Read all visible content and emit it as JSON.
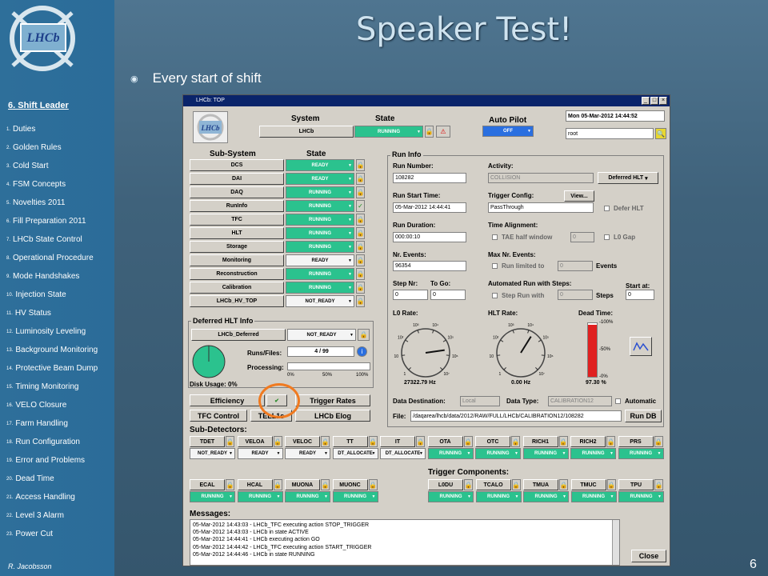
{
  "slide": {
    "title": "Speaker Test!",
    "bullet": "Every start of shift",
    "page_number": "6",
    "author": "R. Jacobsson",
    "logo_text": "LHCb"
  },
  "nav": {
    "heading": "6. Shift Leader",
    "items": [
      {
        "n": "1.",
        "label": "Duties"
      },
      {
        "n": "2.",
        "label": "Golden Rules"
      },
      {
        "n": "3.",
        "label": "Cold Start"
      },
      {
        "n": "4.",
        "label": "FSM Concepts"
      },
      {
        "n": "5.",
        "label": "Novelties 2011"
      },
      {
        "n": "6.",
        "label": "Fill Preparation 2011"
      },
      {
        "n": "7.",
        "label": "LHCb State Control"
      },
      {
        "n": "8.",
        "label": "Operational Procedure"
      },
      {
        "n": "9.",
        "label": "Mode Handshakes"
      },
      {
        "n": "10.",
        "label": "Injection State"
      },
      {
        "n": "11.",
        "label": "HV Status"
      },
      {
        "n": "12.",
        "label": "Luminosity Leveling"
      },
      {
        "n": "13.",
        "label": "Background Monitoring"
      },
      {
        "n": "14.",
        "label": "Protective Beam Dump"
      },
      {
        "n": "15.",
        "label": "Timing Monitoring"
      },
      {
        "n": "16.",
        "label": "VELO Closure"
      },
      {
        "n": "17.",
        "label": "Farm Handling"
      },
      {
        "n": "18.",
        "label": "Run Configuration"
      },
      {
        "n": "19.",
        "label": "Error and Problems"
      },
      {
        "n": "20.",
        "label": "Dead Time"
      },
      {
        "n": "21.",
        "label": "Access Handling"
      },
      {
        "n": "22.",
        "label": "Level 3 Alarm"
      },
      {
        "n": "23.",
        "label": "Power Cut"
      }
    ]
  },
  "window": {
    "title": "LHCb: TOP",
    "system_label": "System",
    "state_label": "State",
    "system_value": "LHCb",
    "system_state": "RUNNING",
    "autopilot_label": "Auto Pilot",
    "autopilot_state": "OFF",
    "datetime": "Mon 05-Mar-2012     14:44:52",
    "user": "root",
    "subsystem_label": "Sub-System",
    "subsystem_state_label": "State",
    "subsystems": [
      {
        "name": "DCS",
        "state": "READY",
        "color": "green"
      },
      {
        "name": "DAI",
        "state": "READY",
        "color": "green"
      },
      {
        "name": "DAQ",
        "state": "RUNNING",
        "color": "green"
      },
      {
        "name": "RunInfo",
        "state": "RUNNING",
        "color": "green"
      },
      {
        "name": "TFC",
        "state": "RUNNING",
        "color": "green"
      },
      {
        "name": "HLT",
        "state": "RUNNING",
        "color": "green"
      },
      {
        "name": "Storage",
        "state": "RUNNING",
        "color": "green"
      },
      {
        "name": "Monitoring",
        "state": "READY",
        "color": "white"
      },
      {
        "name": "Reconstruction",
        "state": "RUNNING",
        "color": "green"
      },
      {
        "name": "Calibration",
        "state": "RUNNING",
        "color": "green"
      },
      {
        "name": "LHCb_HV_TOP",
        "state": "NOT_READY",
        "color": "white"
      }
    ],
    "deferred": {
      "title": "Deferred HLT Info",
      "name": "LHCb_Deferred",
      "state": "NOT_READY",
      "runs_files_label": "Runs/Files:",
      "runs_files": "4 / 99",
      "processing_label": "Processing:",
      "scale": [
        "0%",
        "50%",
        "100%"
      ],
      "disk_usage": "Disk Usage: 0%",
      "disk_usage_fraction": 0.0
    },
    "run_info": {
      "title": "Run Info",
      "run_number_label": "Run Number:",
      "run_number": "108282",
      "activity_label": "Activity:",
      "activity": "COLLISION",
      "deferred_hlt_btn": "Deferred HLT",
      "run_start_label": "Run Start Time:",
      "run_start": "05-Mar-2012 14:44:41",
      "trigger_config_label": "Trigger Config:",
      "trigger_config": "PassThrough",
      "view_btn": "View...",
      "defer_hlt_label": "Defer HLT",
      "run_duration_label": "Run Duration:",
      "run_duration": "000:00:10",
      "time_alignment_label": "Time Alignment:",
      "tae_label": "TAE half window",
      "tae_value": "0",
      "l0gap_label": "L0 Gap",
      "nr_events_label": "Nr. Events:",
      "nr_events": "96354",
      "max_events_label": "Max Nr. Events:",
      "run_limited_label": "Run limited to",
      "run_limited_value": "0",
      "events_label": "Events",
      "step_nr_label": "Step Nr:",
      "step_nr": "0",
      "to_go_label": "To Go:",
      "to_go": "0",
      "automated_label": "Automated Run with Steps:",
      "step_run_label": "Step Run with",
      "step_run_value": "0",
      "steps_label": "Steps",
      "start_at_label": "Start at:",
      "start_at": "0"
    },
    "rates": {
      "l0_label": "L0 Rate:",
      "l0_value": "27322.79 Hz",
      "hlt_label": "HLT Rate:",
      "hlt_value": "0.00 Hz",
      "dead_label": "Dead Time:",
      "dead_value": "97.30 %",
      "dead_fraction": 0.973,
      "dead_scale": [
        "-100%",
        "-50%",
        "-0%"
      ],
      "gauge_ticks": [
        "1",
        "10",
        "10²",
        "10³",
        "10⁴",
        "10⁵",
        "10⁶",
        "10⁷"
      ]
    },
    "buttons": {
      "efficiency": "Efficiency",
      "trigger_rates": "Trigger Rates",
      "tfc_control": "TFC Control",
      "tell1": "TELL1s",
      "lhcb_elog": "LHCb Elog",
      "run_db": "Run DB",
      "close": "Close"
    },
    "data_destination_label": "Data Destination:",
    "data_destination": "Local",
    "data_type_label": "Data Type:",
    "data_type": "CALIBRATION12",
    "automatic_label": "Automatic",
    "file_label": "File:",
    "file_path": "/daqarea/lhcb/data/2012/RAW/FULL/LHCb/CALIBRATION12/108282",
    "subdetectors_label": "Sub-Detectors:",
    "subdetectors_row1": [
      {
        "name": "TDET",
        "state": "NOT_READY",
        "color": "white"
      },
      {
        "name": "VELOA",
        "state": "READY",
        "color": "white"
      },
      {
        "name": "VELOC",
        "state": "READY",
        "color": "white"
      },
      {
        "name": "TT",
        "state": "DT_ALLOCATE",
        "color": "white"
      },
      {
        "name": "IT",
        "state": "DT_ALLOCATE",
        "color": "white"
      },
      {
        "name": "OTA",
        "state": "RUNNING",
        "color": "green"
      },
      {
        "name": "OTC",
        "state": "RUNNING",
        "color": "green"
      },
      {
        "name": "RICH1",
        "state": "RUNNING",
        "color": "green"
      },
      {
        "name": "RICH2",
        "state": "RUNNING",
        "color": "green"
      },
      {
        "name": "PRS",
        "state": "RUNNING",
        "color": "green"
      }
    ],
    "subdetectors_row2": [
      {
        "name": "ECAL",
        "state": "RUNNING",
        "color": "green"
      },
      {
        "name": "HCAL",
        "state": "RUNNING",
        "color": "green"
      },
      {
        "name": "MUONA",
        "state": "RUNNING",
        "color": "green"
      },
      {
        "name": "MUONC",
        "state": "RUNNING",
        "color": "green"
      }
    ],
    "trigger_components_label": "Trigger Components:",
    "trigger_components": [
      {
        "name": "L0DU",
        "state": "RUNNING",
        "color": "green"
      },
      {
        "name": "TCALO",
        "state": "RUNNING",
        "color": "green"
      },
      {
        "name": "TMUA",
        "state": "RUNNING",
        "color": "green"
      },
      {
        "name": "TMUC",
        "state": "RUNNING",
        "color": "green"
      },
      {
        "name": "TPU",
        "state": "RUNNING",
        "color": "green"
      }
    ],
    "messages_label": "Messages:",
    "messages": [
      "05-Mar-2012 14:43:03 - LHCb_TFC executing action STOP_TRIGGER",
      "05-Mar-2012 14:43:03 - LHCb in state ACTIVE",
      "05-Mar-2012 14:44:41 - LHCb executing action GO",
      "05-Mar-2012 14:44:42 - LHCb_TFC executing action START_TRIGGER",
      "05-Mar-2012 14:44:46 - LHCb in state RUNNING"
    ]
  },
  "colors": {
    "running": "#2bc28e",
    "autopilot": "#2a6fe0",
    "deadtime": "#e02020",
    "slide_bg": "#3f627b",
    "annotation": "#f07a20"
  }
}
